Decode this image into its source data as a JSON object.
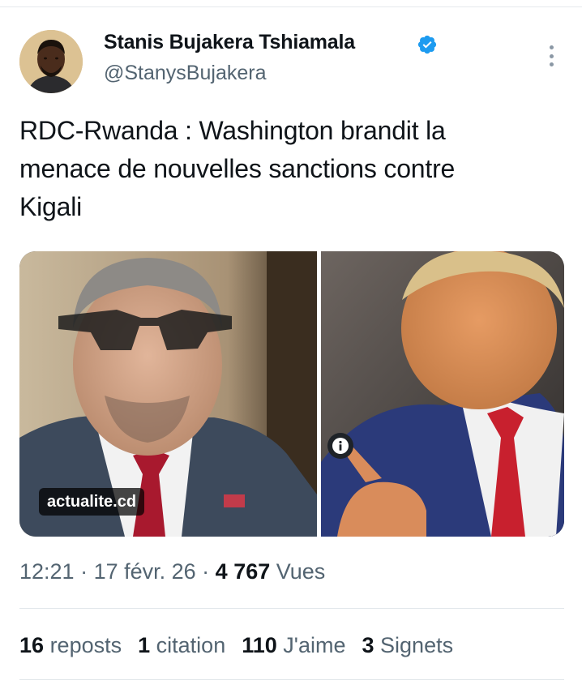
{
  "author": {
    "name": "Stanis Bujakera Tshiamala",
    "handle": "@StanysBujakera",
    "verified_color": "#1d9bf0"
  },
  "tweet": {
    "text_line1": "RDC-Rwanda : Washington brandit la",
    "text_line2": "menace de nouvelles sanctions contre",
    "text_line3": "Kigali"
  },
  "media": {
    "source_badge": "actualite.cd",
    "info_icon": "info-icon"
  },
  "meta": {
    "time": "12:21",
    "sep1": " · ",
    "date": "17 févr. 26",
    "sep2": " · ",
    "views_count": "4 767",
    "views_label": "Vues"
  },
  "stats": [
    {
      "count": "16",
      "label": "reposts"
    },
    {
      "count": "1",
      "label": "citation"
    },
    {
      "count": "110",
      "label": "J'aime"
    },
    {
      "count": "3",
      "label": "Signets"
    }
  ],
  "colors": {
    "text_primary": "#0f1419",
    "text_secondary": "#536471",
    "divider": "#e1e6ea"
  }
}
